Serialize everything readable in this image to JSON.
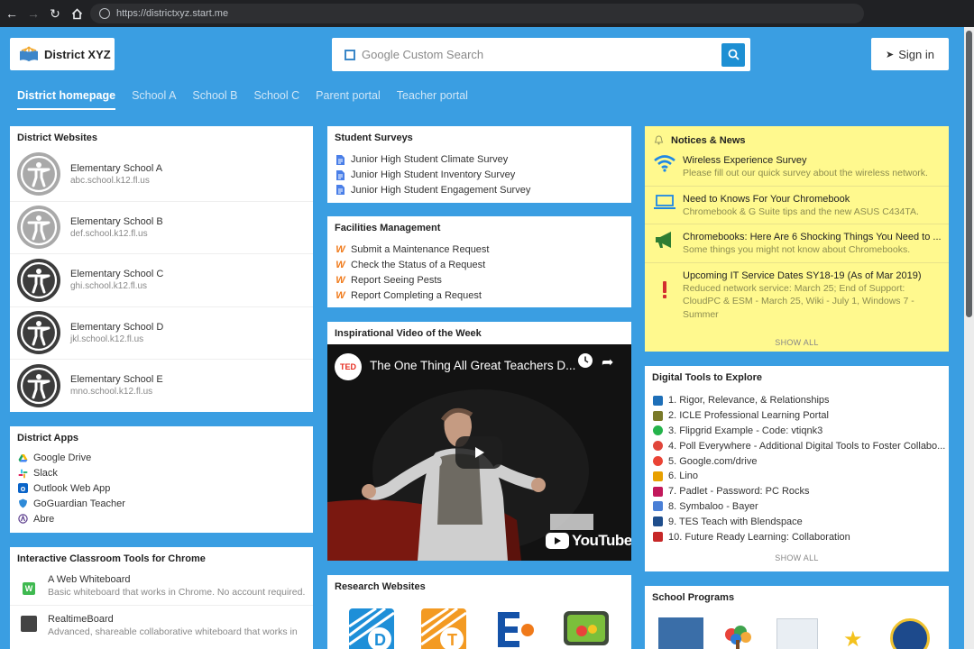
{
  "browser": {
    "url": "https://districtxyz.start.me"
  },
  "header": {
    "logo_text": "District XYZ",
    "search_placeholder": "Google Custom Search",
    "sign_in": "Sign in",
    "tabs": [
      "District homepage",
      "School A",
      "School B",
      "School C",
      "Parent portal",
      "Teacher portal"
    ]
  },
  "district_websites": {
    "title": "District Websites",
    "items": [
      {
        "name": "Elementary School A",
        "url": "abc.school.k12.fl.us",
        "badge_color": "#a9a9a9"
      },
      {
        "name": "Elementary School B",
        "url": "def.school.k12.fl.us",
        "badge_color": "#a9a9a9"
      },
      {
        "name": "Elementary School C",
        "url": "ghi.school.k12.fl.us",
        "badge_color": "#3c3c3c"
      },
      {
        "name": "Elementary School D",
        "url": "jkl.school.k12.fl.us",
        "badge_color": "#3c3c3c"
      },
      {
        "name": "Elementary School E",
        "url": "mno.school.k12.fl.us",
        "badge_color": "#3c3c3c"
      }
    ]
  },
  "district_apps": {
    "title": "District Apps",
    "items": [
      {
        "label": "Google Drive",
        "icon": "google-drive-icon"
      },
      {
        "label": "Slack",
        "icon": "slack-icon"
      },
      {
        "label": "Outlook Web App",
        "icon": "outlook-icon"
      },
      {
        "label": "GoGuardian Teacher",
        "icon": "goguardian-icon"
      },
      {
        "label": "Abre",
        "icon": "abre-icon"
      }
    ]
  },
  "classroom_tools": {
    "title": "Interactive Classroom Tools for Chrome",
    "items": [
      {
        "title": "A Web Whiteboard",
        "desc": "Basic whiteboard that works in Chrome. No account required."
      },
      {
        "title": "RealtimeBoard",
        "desc": "Advanced, shareable collaborative whiteboard that works in"
      }
    ]
  },
  "student_surveys": {
    "title": "Student Surveys",
    "items": [
      "Junior High Student Climate Survey",
      "Junior High Student Inventory Survey",
      "Junior High Student Engagement Survey"
    ]
  },
  "facilities": {
    "title": "Facilities Management",
    "items": [
      "Submit a Maintenance Request",
      "Check the Status of a Request",
      "Report Seeing Pests",
      "Report Completing a Request"
    ]
  },
  "video_widget": {
    "title": "Inspirational Video of the Week",
    "video_title": "The One Thing All Great Teachers D...",
    "youtube": "YouTube"
  },
  "research": {
    "title": "Research Websites"
  },
  "notices": {
    "title": "Notices & News",
    "items": [
      {
        "title": "Wireless Experience Survey",
        "sub": "Please fill out our quick survey about the wireless network.",
        "icon": "wifi-icon"
      },
      {
        "title": "Need to Knows For Your Chromebook",
        "sub": "Chromebook & G Suite tips and the new ASUS C434TA.",
        "icon": "laptop-icon"
      },
      {
        "title": "Chromebooks: Here Are 6 Shocking Things You Need to ...",
        "sub": "Some things you might not know about Chromebooks.",
        "icon": "megaphone-icon"
      },
      {
        "title": "Upcoming IT Service Dates SY18-19 (As of Mar 2019)",
        "sub": "Reduced network service: March 25; End of Support: CloudPC & ESM - March 25, Wiki - July 1, Windows 7 - Summer",
        "icon": "exclamation-icon"
      }
    ],
    "show_all": "SHOW ALL"
  },
  "digital_tools": {
    "title": "Digital Tools to Explore",
    "items": [
      {
        "label": "1. Rigor, Relevance, & Relationships",
        "color": "#1e6fb8"
      },
      {
        "label": "2. ICLE Professional Learning Portal",
        "color": "#7a7a2a"
      },
      {
        "label": "3. Flipgrid Example - Code: vtiqnk3",
        "color": "#25b34b"
      },
      {
        "label": "4. Poll Everywhere - Additional Digital Tools to Foster Collabo...",
        "color": "#e0453a"
      },
      {
        "label": "5. Google.com/drive",
        "color": "#ea4335"
      },
      {
        "label": "6. Lino",
        "color": "#e8a000"
      },
      {
        "label": "7. Padlet - Password: PC Rocks",
        "color": "#c2185b"
      },
      {
        "label": "8. Symbaloo - Bayer",
        "color": "#4a7fd6"
      },
      {
        "label": "9. TES Teach with Blendspace",
        "color": "#1f4e8c"
      },
      {
        "label": "10. Future Ready Learning: Collaboration",
        "color": "#c62828"
      }
    ],
    "show_all": "SHOW ALL"
  },
  "school_programs": {
    "title": "School Programs"
  }
}
